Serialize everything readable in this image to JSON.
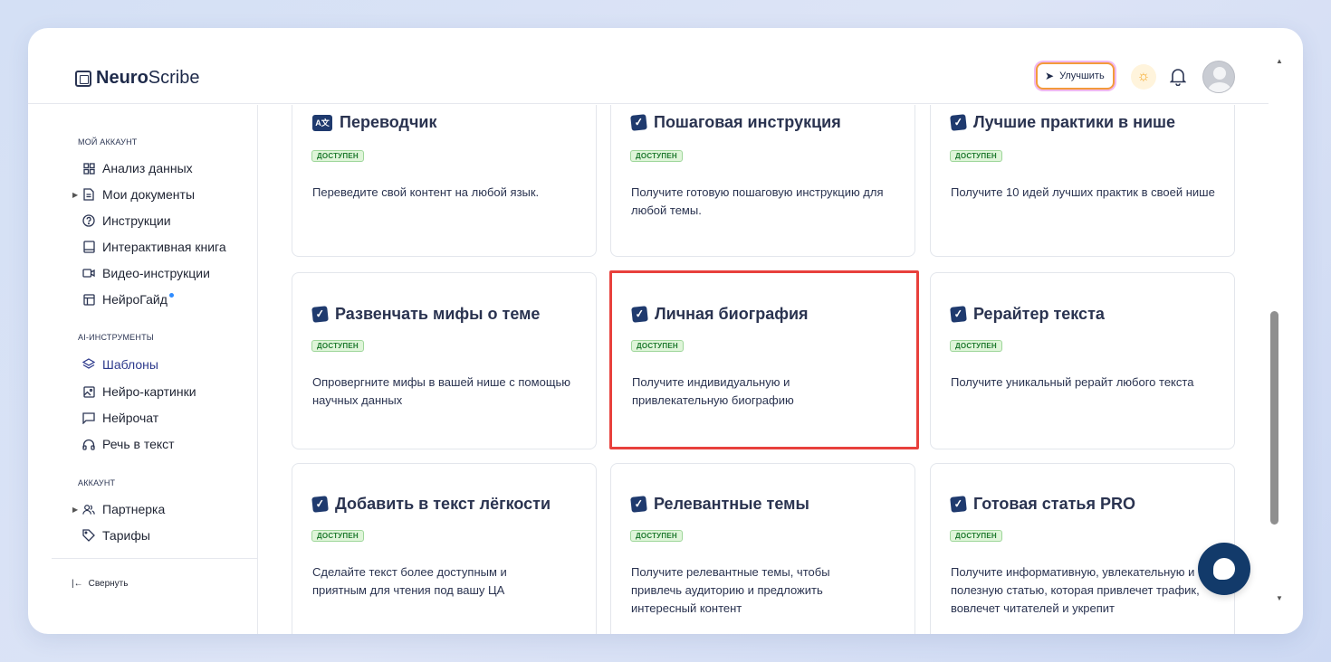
{
  "brand": {
    "bold": "Neuro",
    "light": "Scribe"
  },
  "header": {
    "upgrade_label": "Улучшить"
  },
  "sidebar": {
    "sections": [
      {
        "title": "МОЙ АККАУНТ"
      },
      {
        "title": "AI-ИНСТРУМЕНТЫ"
      },
      {
        "title": "АККАУНТ"
      }
    ],
    "items": [
      {
        "label": "Анализ данных",
        "icon": "grid-icon"
      },
      {
        "label": "Мои документы",
        "icon": "document-icon"
      },
      {
        "label": "Инструкции",
        "icon": "help-circle-icon"
      },
      {
        "label": "Интерактивная книга",
        "icon": "book-icon"
      },
      {
        "label": "Видео-инструкции",
        "icon": "video-icon"
      },
      {
        "label": "НейроГайд",
        "icon": "layout-icon"
      },
      {
        "label": "Шаблоны",
        "icon": "layers-icon"
      },
      {
        "label": "Нейро-картинки",
        "icon": "image-icon"
      },
      {
        "label": "Нейрочат",
        "icon": "chat-icon"
      },
      {
        "label": "Речь в текст",
        "icon": "headphones-icon"
      },
      {
        "label": "Партнерка",
        "icon": "users-icon"
      },
      {
        "label": "Тарифы",
        "icon": "tag-icon"
      }
    ],
    "collapse_label": "Свернуть"
  },
  "cards": [
    {
      "title": "Переводчик",
      "badge": "ДОСТУПЕН",
      "desc": "Переведите свой контент на любой язык."
    },
    {
      "title": "Пошаговая инструкция",
      "badge": "ДОСТУПЕН",
      "desc": "Получите готовую пошаговую инструкцию для любой темы."
    },
    {
      "title": "Лучшие практики в нише",
      "badge": "ДОСТУПЕН",
      "desc": "Получите 10 идей лучших практик в своей нише"
    },
    {
      "title": "Развенчать мифы о теме",
      "badge": "ДОСТУПЕН",
      "desc": "Опровергните мифы в вашей нише с помощью научных данных"
    },
    {
      "title": "Личная биография",
      "badge": "ДОСТУПЕН",
      "desc": "Получите индивидуальную и привлекательную биографию"
    },
    {
      "title": "Рерайтер текста",
      "badge": "ДОСТУПЕН",
      "desc": "Получите уникальный рерайт любого текста"
    },
    {
      "title": "Добавить в текст лёгкости",
      "badge": "ДОСТУПЕН",
      "desc": "Сделайте текст более доступным и приятным для чтения под вашу ЦА"
    },
    {
      "title": "Релевантные темы",
      "badge": "ДОСТУПЕН",
      "desc": "Получите релевантные темы, чтобы привлечь аудиторию и предложить интересный контент"
    },
    {
      "title": "Готовая статья PRO",
      "badge": "ДОСТУПЕН",
      "desc": "Получите информативную, увлекательную и полезную статью, которая привлечет трафик, вовлечет читателей и укрепит"
    }
  ],
  "colors": {
    "accent": "#1f3a6e",
    "highlight": "#e8403c",
    "badge_bg": "#dff5d9",
    "badge_text": "#1f7a2f"
  }
}
